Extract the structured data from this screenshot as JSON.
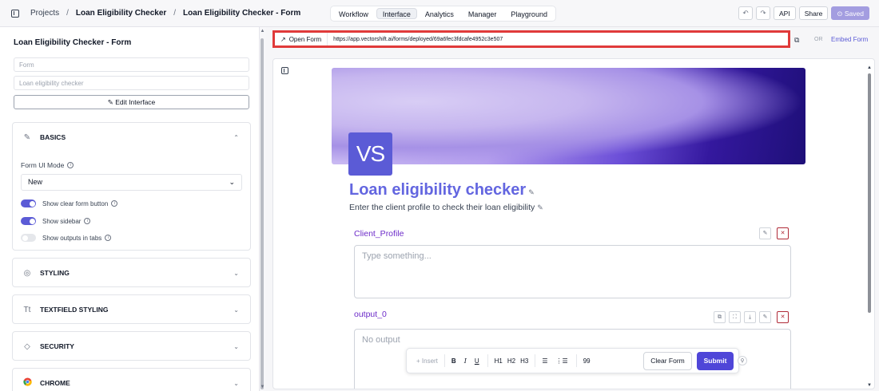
{
  "breadcrumb": {
    "projects": "Projects",
    "sep": "/",
    "project": "Loan Eligibility Checker",
    "page": "Loan Eligibility Checker - Form"
  },
  "tabs": [
    "Workflow",
    "Interface",
    "Analytics",
    "Manager",
    "Playground"
  ],
  "active_tab": "Interface",
  "toolbar": {
    "undo": "↶",
    "redo": "↷",
    "api": "API",
    "share": "Share",
    "saved": "⊙ Saved"
  },
  "left_panel": {
    "title": "Loan Eligibility Checker - Form",
    "form_type": "Form",
    "description": "Loan eligibility checker",
    "edit_interface": "Edit Interface",
    "sections": {
      "basics": "BASICS",
      "styling": "STYLING",
      "textfield_styling": "TEXTFIELD STYLING",
      "security": "SECURITY",
      "chrome": "CHROME"
    },
    "form_ui_mode_label": "Form UI Mode",
    "form_ui_mode_value": "New",
    "toggles": [
      {
        "label": "Show clear form button",
        "on": true
      },
      {
        "label": "Show sidebar",
        "on": true
      },
      {
        "label": "Show outputs in tabs",
        "on": false
      }
    ]
  },
  "url_bar": {
    "open_form": "Open Form",
    "url": "https://app.vectorshift.ai/forms/deployed/69a6fec3fdcafe4952c3e507",
    "or": "OR",
    "embed": "Embed Form"
  },
  "form": {
    "logo": "VS",
    "title": "Loan eligibility checker",
    "subtitle": "Enter the client profile to check their loan eligibility",
    "fields": [
      {
        "label": "Client_Profile",
        "placeholder": "Type something..."
      },
      {
        "label": "output_0",
        "placeholder": "No output"
      }
    ]
  },
  "editor_toolbar": {
    "insert": "+ Insert",
    "bold": "B",
    "italic": "I",
    "underline": "U",
    "h1": "H1",
    "h2": "H2",
    "h3": "H3",
    "bullets": "☰",
    "numbered": "⋮☰",
    "quote": "99",
    "clear": "Clear Form",
    "submit": "Submit"
  },
  "colors": {
    "accent": "#5b5bd6",
    "highlight_border": "#e03a3a",
    "title": "#6366e0",
    "field_label": "#6d2cc9"
  }
}
